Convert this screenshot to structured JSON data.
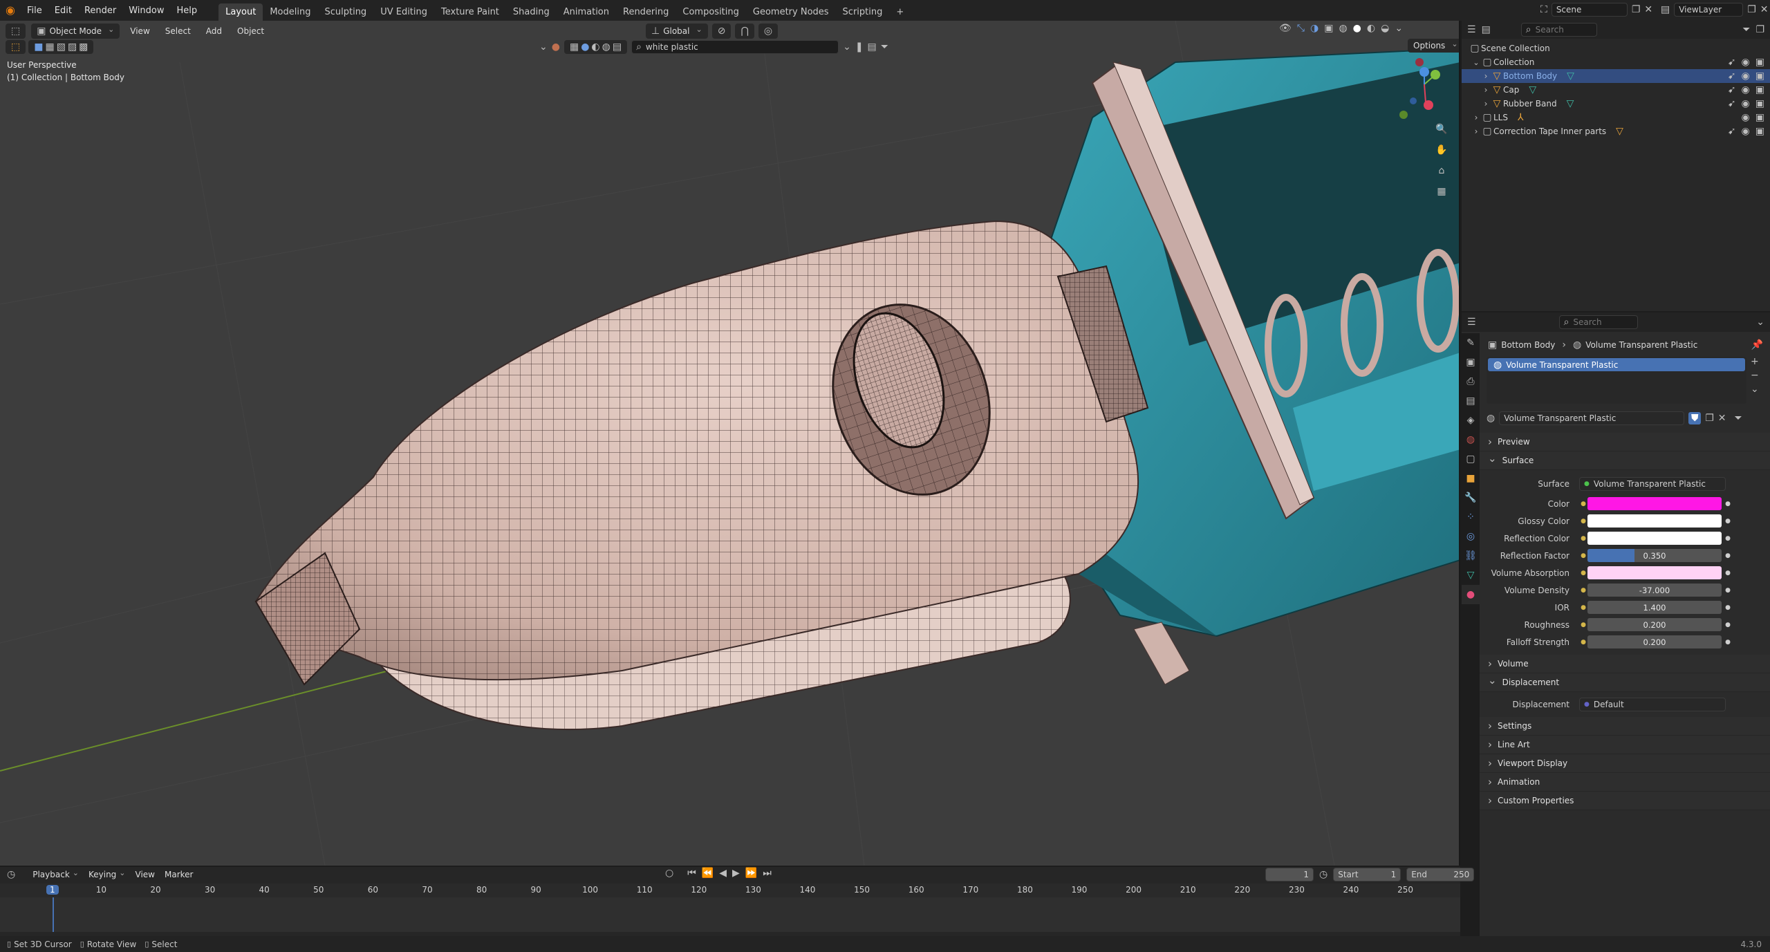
{
  "topbar": {
    "menus": [
      "File",
      "Edit",
      "Render",
      "Window",
      "Help"
    ],
    "workspaces": [
      "Layout",
      "Modeling",
      "Sculpting",
      "UV Editing",
      "Texture Paint",
      "Shading",
      "Animation",
      "Rendering",
      "Compositing",
      "Geometry Nodes",
      "Scripting"
    ],
    "active_workspace": "Layout",
    "add_tab": "+",
    "scene": "Scene",
    "view_layer": "ViewLayer"
  },
  "viewport_header": {
    "mode": "Object Mode",
    "menus": [
      "View",
      "Select",
      "Add",
      "Object"
    ],
    "transform_orientation": "Global",
    "options": "Options",
    "search_value": "white plastic"
  },
  "viewport_overlay": {
    "perspective": "User Perspective",
    "context": "(1) Collection | Bottom Body"
  },
  "outliner": {
    "search_placeholder": "Search",
    "rows": [
      {
        "label": "Scene Collection",
        "indent": 0
      },
      {
        "label": "Collection",
        "indent": 1
      },
      {
        "label": "Bottom Body",
        "indent": 2,
        "selected": true
      },
      {
        "label": "Cap",
        "indent": 2
      },
      {
        "label": "Rubber Band",
        "indent": 2
      },
      {
        "label": "LLS",
        "indent": 1
      },
      {
        "label": "Correction Tape Inner parts",
        "indent": 1
      }
    ]
  },
  "properties": {
    "search_placeholder": "Search",
    "breadcrumb_object": "Bottom Body",
    "breadcrumb_material": "Volume Transparent Plastic",
    "slot_name": "Volume Transparent Plastic",
    "material_name": "Volume Transparent Plastic",
    "panels_top": [
      "Preview",
      "Surface"
    ],
    "surface_label": "Surface",
    "surface_value": "Volume Transparent Plastic",
    "inputs": [
      {
        "label": "Color",
        "type": "color",
        "color": "#ff17e5"
      },
      {
        "label": "Glossy Color",
        "type": "color",
        "color": "#ffffff"
      },
      {
        "label": "Reflection Color",
        "type": "color",
        "color": "#ffffff"
      },
      {
        "label": "Reflection Factor",
        "type": "slider",
        "value": "0.350",
        "fraction": 0.35
      },
      {
        "label": "Volume Absorption",
        "type": "color",
        "color": "#ffd2f5"
      },
      {
        "label": "Volume Density",
        "type": "number",
        "value": "-37.000"
      },
      {
        "label": "IOR",
        "type": "number",
        "value": "1.400"
      },
      {
        "label": "Roughness",
        "type": "number",
        "value": "0.200"
      },
      {
        "label": "Falloff Strength",
        "type": "number",
        "value": "0.200"
      }
    ],
    "volume_panel": "Volume",
    "displacement_panel": "Displacement",
    "displacement_label": "Displacement",
    "displacement_value": "Default",
    "panels_bottom": [
      "Settings",
      "Line Art",
      "Viewport Display",
      "Animation",
      "Custom Properties"
    ]
  },
  "timeline": {
    "menus": [
      "Playback",
      "Keying",
      "View",
      "Marker"
    ],
    "current_frame": "1",
    "start_label": "Start",
    "start_value": "1",
    "end_label": "End",
    "end_value": "250",
    "ticks": [
      "1",
      "10",
      "20",
      "30",
      "40",
      "50",
      "60",
      "70",
      "80",
      "90",
      "100",
      "110",
      "120",
      "130",
      "140",
      "150",
      "160",
      "170",
      "180",
      "190",
      "200",
      "210",
      "220",
      "230",
      "240",
      "250"
    ]
  },
  "statusbar": {
    "hints": [
      "Set 3D Cursor",
      "Rotate View",
      "Select"
    ],
    "version": "4.3.0"
  },
  "colors": {
    "accent": "#4772b3",
    "selected_row": "#334d80",
    "mesh_fill": "#d9bdb4",
    "teal": "#2f9fb0"
  }
}
